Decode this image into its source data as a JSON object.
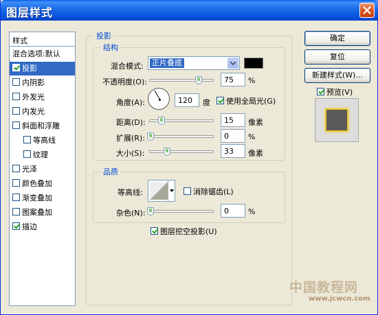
{
  "window": {
    "title": "图层样式"
  },
  "styles_panel": {
    "header": "样式",
    "blend_options": "混合选项:默认",
    "items": [
      {
        "label": "投影",
        "checked": true,
        "selected": true,
        "indent": false
      },
      {
        "label": "内阴影",
        "checked": false,
        "selected": false,
        "indent": false
      },
      {
        "label": "外发光",
        "checked": false,
        "selected": false,
        "indent": false
      },
      {
        "label": "内发光",
        "checked": false,
        "selected": false,
        "indent": false
      },
      {
        "label": "斜面和浮雕",
        "checked": false,
        "selected": false,
        "indent": false
      },
      {
        "label": "等高线",
        "checked": false,
        "selected": false,
        "indent": true
      },
      {
        "label": "纹理",
        "checked": false,
        "selected": false,
        "indent": true
      },
      {
        "label": "光泽",
        "checked": false,
        "selected": false,
        "indent": false
      },
      {
        "label": "颜色叠加",
        "checked": false,
        "selected": false,
        "indent": false
      },
      {
        "label": "渐变叠加",
        "checked": false,
        "selected": false,
        "indent": false
      },
      {
        "label": "图案叠加",
        "checked": false,
        "selected": false,
        "indent": false
      },
      {
        "label": "描边",
        "checked": true,
        "selected": false,
        "indent": false
      }
    ]
  },
  "drop_shadow": {
    "section_title": "投影",
    "structure": {
      "title": "结构",
      "blend_mode_label": "混合模式:",
      "blend_mode_value": "正片叠底",
      "shadow_color": "#000000",
      "opacity_label": "不透明度(O):",
      "opacity_value": "75",
      "opacity_unit": "%",
      "opacity_fraction": 0.75,
      "angle_label": "角度(A):",
      "angle_value": "120",
      "angle_unit": "度",
      "global_light_label": "使用全局光(G)",
      "global_light_checked": true,
      "distance_label": "距离(D):",
      "distance_value": "15",
      "distance_unit": "像素",
      "spread_label": "扩展(R):",
      "spread_value": "0",
      "spread_unit": "%",
      "size_label": "大小(S):",
      "size_value": "33",
      "size_unit": "像素"
    },
    "quality": {
      "title": "品质",
      "contour_label": "等高线:",
      "anti_alias_label": "消除锯齿(L)",
      "anti_alias_checked": false,
      "noise_label": "杂色(N):",
      "noise_value": "0",
      "noise_unit": "%"
    },
    "knockout_label": "图层挖空投影(U)",
    "knockout_checked": true
  },
  "buttons": {
    "ok": "确定",
    "reset": "复位",
    "new_style": "新建样式(W)...",
    "preview_label": "预览(V)",
    "preview_checked": true
  },
  "watermark": {
    "text": "中国教程网",
    "url": "www.jcwcn.com"
  }
}
